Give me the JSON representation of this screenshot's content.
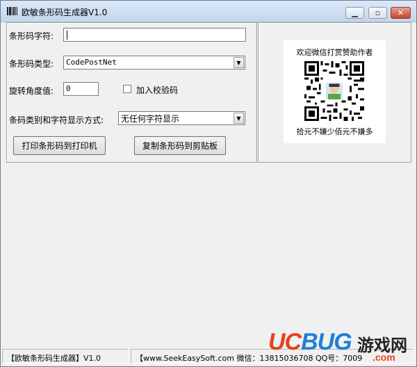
{
  "window": {
    "title": "欧敏条形码生成器V1.0",
    "app_icon": "barcode-icon",
    "controls": {
      "minimize": "minimize-icon",
      "maximize": "maximize-icon",
      "close": "close-icon"
    }
  },
  "form": {
    "barcode_text_label": "条形码字符:",
    "barcode_text_value": "",
    "barcode_type_label": "条形码类型:",
    "barcode_type_value": "CodePostNet",
    "rotation_label": "旋转角度值:",
    "rotation_value": "0",
    "checksum_label": "加入校验码",
    "checksum_checked": false,
    "display_mode_label": "条码类别和字符显示方式:",
    "display_mode_value": "无任何字符显示"
  },
  "actions": {
    "print_label": "打印条形码到打印机",
    "copy_label": "复制条形码到剪贴板"
  },
  "donation": {
    "top_text": "欢迎微信打赏赞助作者",
    "bottom_text": "拾元不嫌少佰元不嫌多"
  },
  "statusbar": {
    "app_info": "【欧敏条形码生成器】V1.0",
    "contact_info": "【www.SeekEasySoft.com 微信：13815036708 QQ号：7009"
  },
  "watermark": {
    "brand": "UCBUG",
    "suffix": "游戏网",
    "domain": ".com"
  },
  "colors": {
    "watermark_uc": "#e8401c",
    "watermark_bug": "#1e7fd8",
    "window_bg": "#f0f0f0"
  }
}
